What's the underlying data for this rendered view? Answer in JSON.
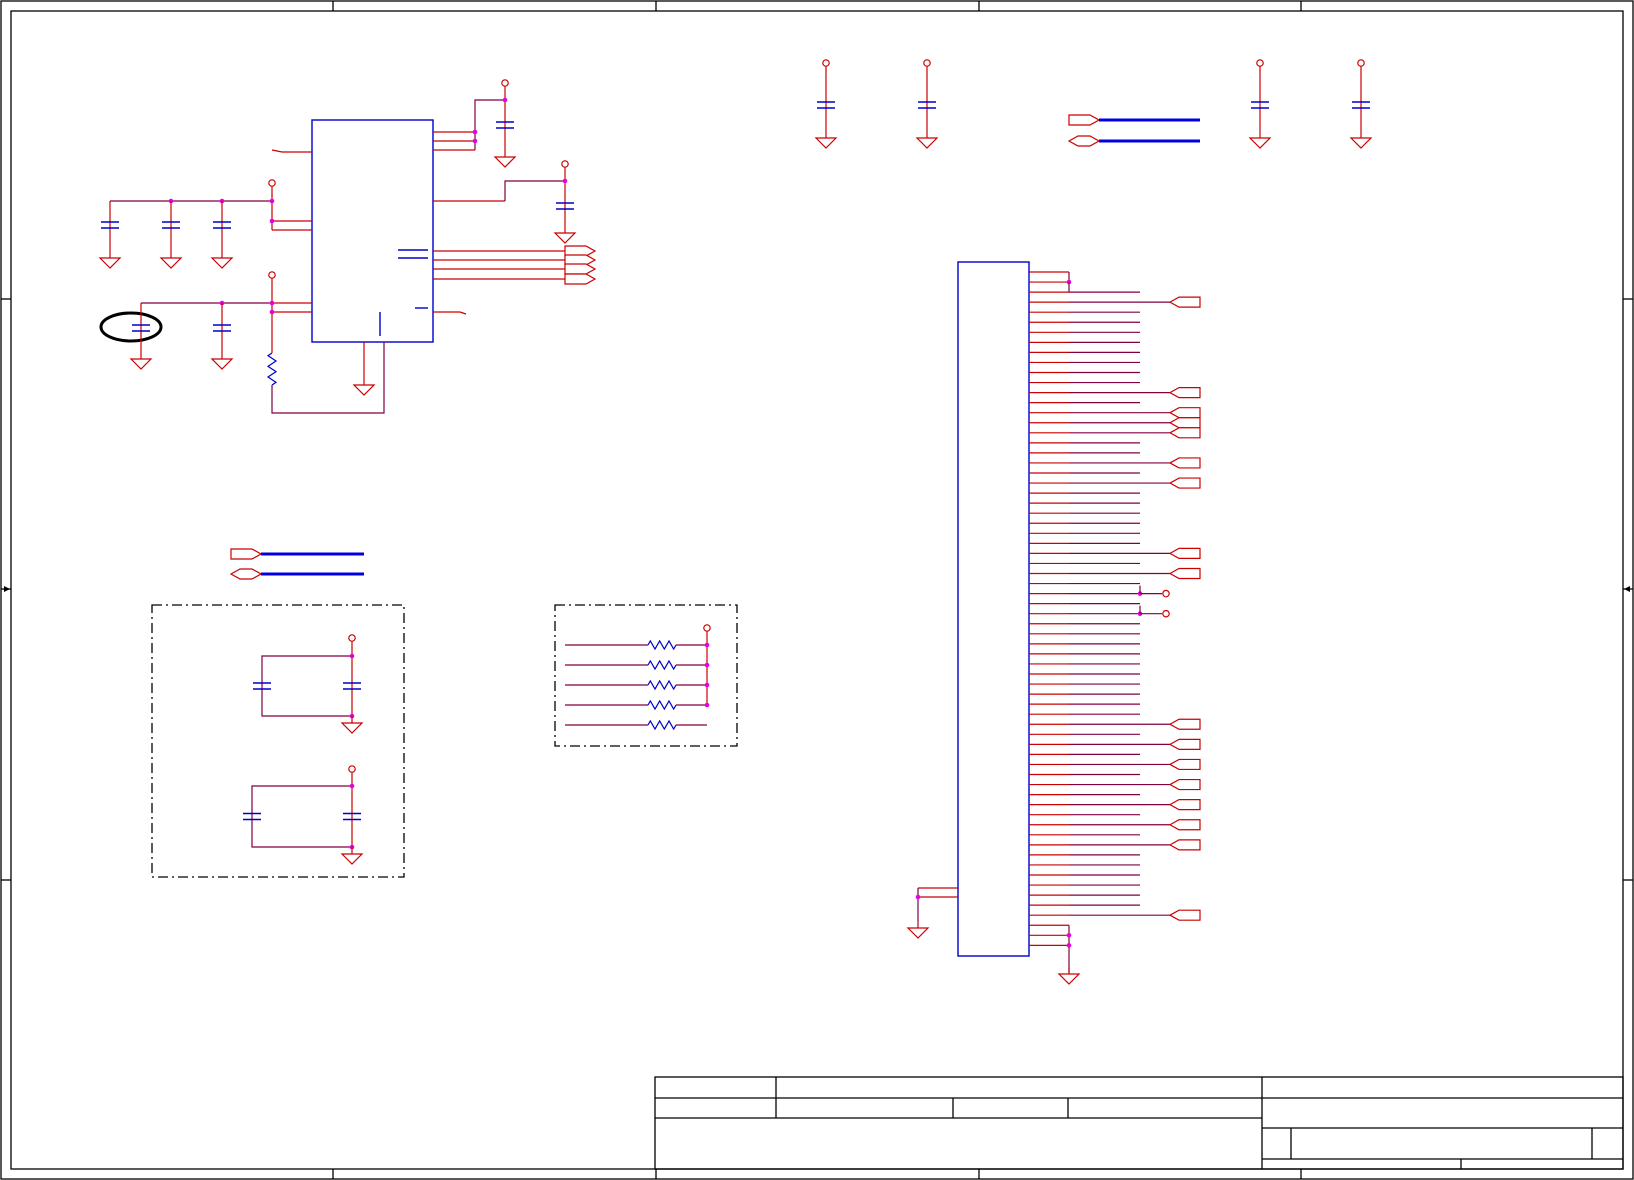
{
  "diagram": {
    "kind": "electrical-schematic",
    "labels": [],
    "colors": {
      "wire": "#cc0000",
      "net": "#800040",
      "component": "#0000cc",
      "bus": "#0000e6",
      "junction": "#e600e6",
      "frame": "#000000",
      "highlight": "#000000"
    },
    "icons": [
      "capacitor-icon",
      "resistor-icon",
      "ground-icon",
      "power-pin-icon",
      "off-page-connector-icon",
      "connector-header-icon",
      "ic-chip-icon"
    ],
    "highlight_marker": "circled-capacitor",
    "title_block": {
      "visible": true,
      "text": []
    }
  }
}
